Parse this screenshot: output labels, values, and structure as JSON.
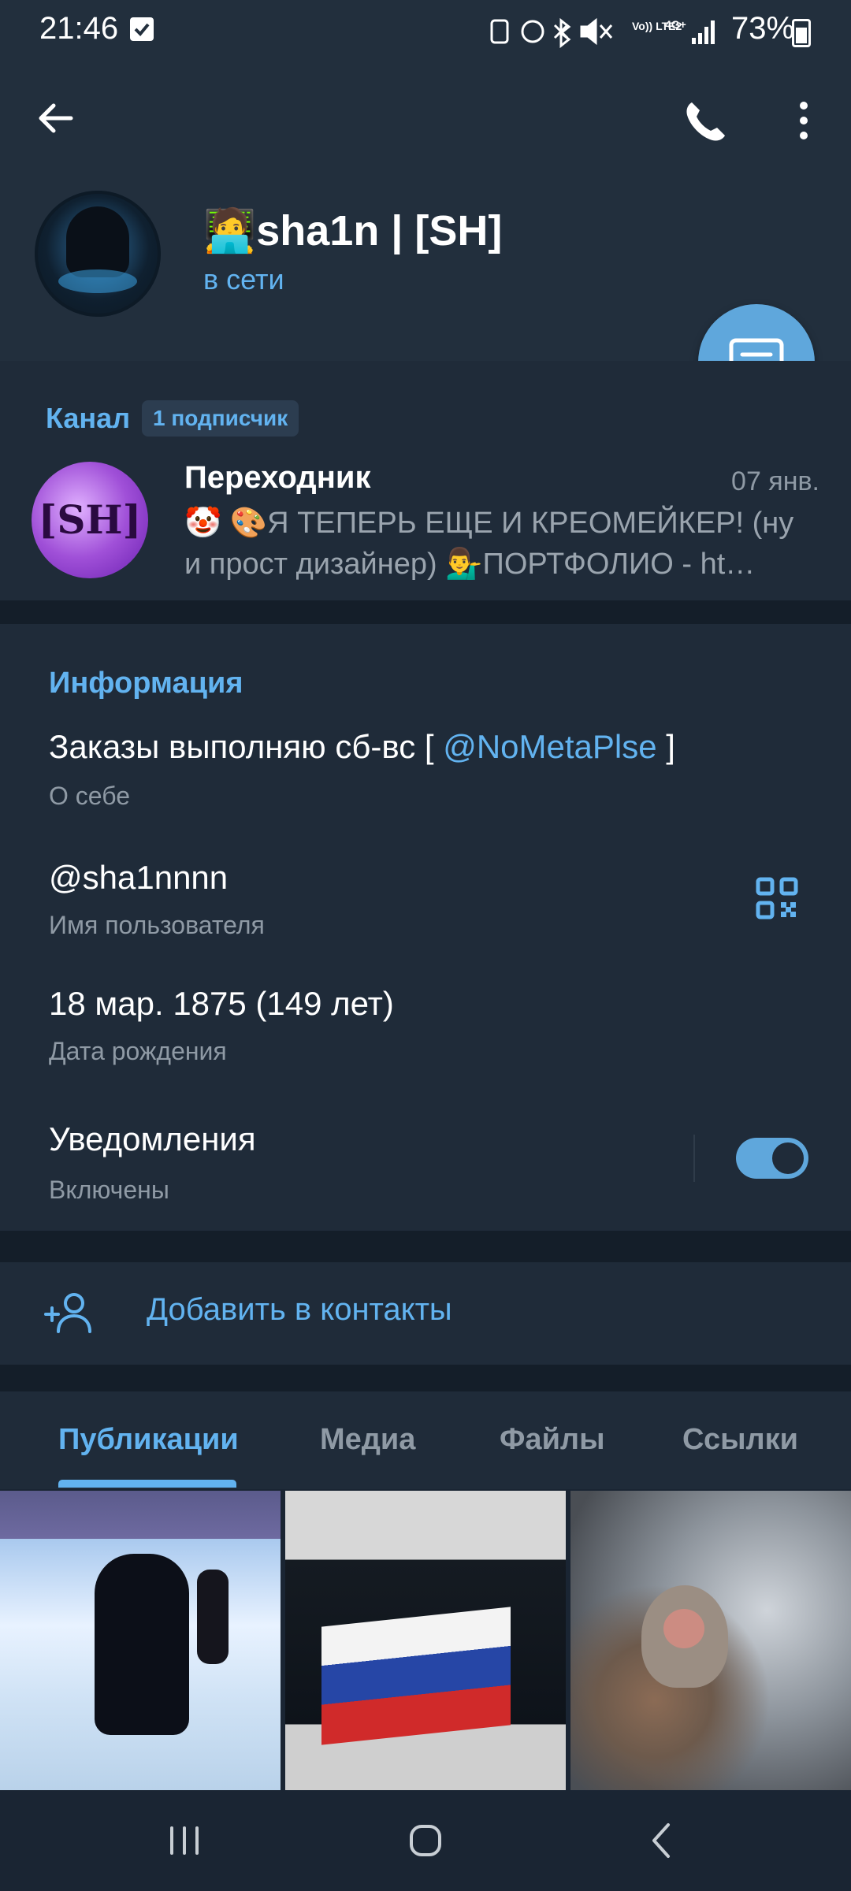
{
  "status_bar": {
    "time": "21:46",
    "battery": "73%",
    "icons": [
      "notification-check-icon",
      "recycle-icon",
      "alarm-icon",
      "bluetooth-icon",
      "mute-icon",
      "volte-icon",
      "signal-4g-icon",
      "signal-icon",
      "battery-icon"
    ],
    "volte_text": "Vo)) LTE2",
    "network_text": "4G+"
  },
  "header": {
    "name": "🧑‍💻sha1n | [SH]",
    "status": "в сети"
  },
  "channel": {
    "label": "Канал",
    "badge": "1 подписчик",
    "title": "Переходник",
    "date": "07 янв.",
    "preview": "🤡 🎨Я ТЕПЕРЬ ЕЩЕ И КРЕОМЕЙКЕР! (ну и прост дизайнер) 💁‍♂️ПОРТФОЛИО - ht…",
    "avatar_text": "[SH]"
  },
  "info": {
    "title": "Информация",
    "bio_prefix": "Заказы выполняю сб-вс [ ",
    "bio_mention": "@NoMetaPlse",
    "bio_suffix": " ]",
    "bio_label": "О себе",
    "username": "@sha1nnnn",
    "username_label": "Имя пользователя",
    "birthday": "18 мар. 1875 (149 лет)",
    "birthday_label": "Дата рождения",
    "notifications": "Уведомления",
    "notifications_state": "Включены"
  },
  "actions": {
    "add_contact": "Добавить в контакты"
  },
  "tabs": [
    {
      "label": "Публикации",
      "active": true
    },
    {
      "label": "Медиа",
      "active": false
    },
    {
      "label": "Файлы",
      "active": false
    },
    {
      "label": "Ссылки",
      "active": false
    }
  ],
  "colors": {
    "accent": "#62b3f0",
    "background": "#1a2533",
    "card": "#1f2b39",
    "fab": "#5fa7dc"
  }
}
